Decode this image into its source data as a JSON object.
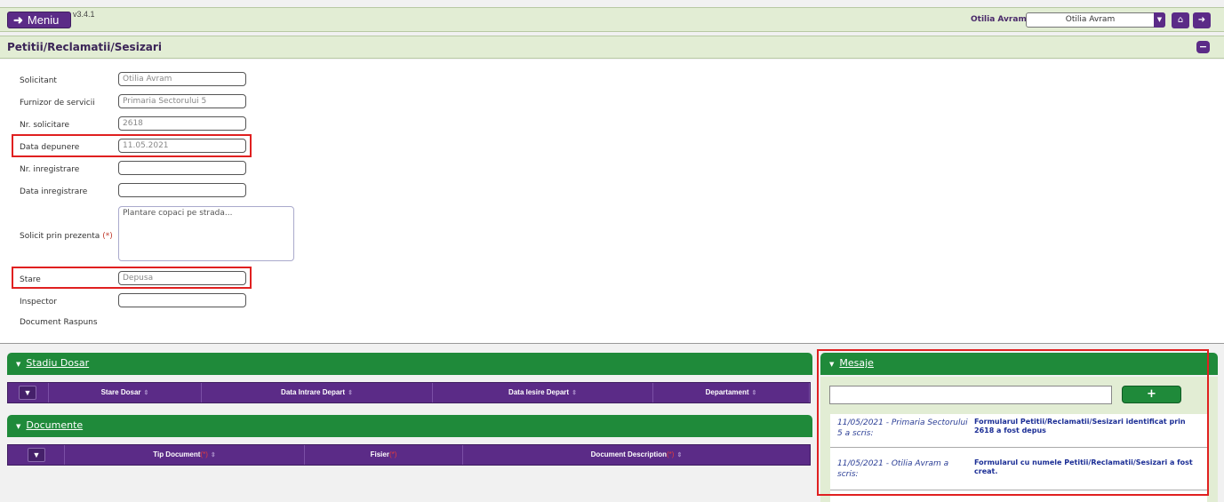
{
  "topbar": {
    "menu_label": "Meniu",
    "version": "v3.4.1",
    "user_label": "Otilia Avram",
    "user_select_value": "Otilia Avram"
  },
  "section": {
    "title": "Petitii/Reclamatii/Sesizari"
  },
  "form": {
    "solicitant_label": "Solicitant",
    "solicitant_value": "Otilia Avram",
    "furnizor_label": "Furnizor de servicii",
    "furnizor_value": "Primaria Sectorului 5",
    "nr_solicitare_label": "Nr. solicitare",
    "nr_solicitare_value": "2618",
    "data_depunere_label": "Data depunere",
    "data_depunere_value": "11.05.2021",
    "nr_inregistrare_label": "Nr. inregistrare",
    "nr_inregistrare_value": "",
    "data_inregistrare_label": "Data inregistrare",
    "data_inregistrare_value": "",
    "solicit_label": "Solicit prin prezenta",
    "solicit_req": "(*)",
    "solicit_value": "Plantare copaci pe strada...",
    "stare_label": "Stare",
    "stare_value": "Depusa",
    "inspector_label": "Inspector",
    "inspector_value": "",
    "document_raspuns_label": "Document Raspuns"
  },
  "stadiu": {
    "title": "Stadiu Dosar",
    "columns": [
      "Stare Dosar",
      "Data Intrare Depart",
      "Data Iesire Depart",
      "Departament"
    ]
  },
  "documente": {
    "title": "Documente",
    "columns": [
      "Tip Document",
      "Fisier",
      "Document Description"
    ],
    "req_marker": "(*)"
  },
  "mesaje": {
    "title": "Mesaje",
    "add_label": "+",
    "messages": [
      {
        "author": "11/05/2021 - Primaria Sectorului 5 a scris:",
        "text": "Formularul Petitii/Reclamatii/Sesizari identificat prin 2618 a fost depus"
      },
      {
        "author": "11/05/2021 - Otilia Avram a scris:",
        "text": "Formularul cu numele Petitii/Reclamatii/Sesizari a fost creat."
      }
    ]
  },
  "colors": {
    "purple": "#5b2b87",
    "green": "#1f8a3a",
    "light_green": "#e2edd4",
    "highlight_red": "#e02020"
  }
}
